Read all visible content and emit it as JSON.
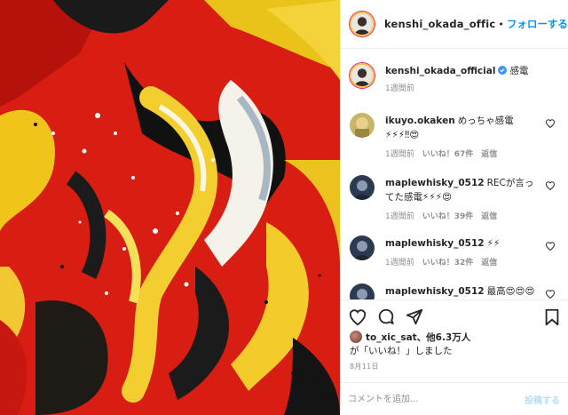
{
  "header": {
    "username": "kenshi_okada_offic",
    "separator": "•",
    "follow_label": "フォローする"
  },
  "caption": {
    "username": "kenshi_okada_official",
    "text": "感電",
    "time": "1週間前"
  },
  "comments": [
    {
      "user": "ikuyo.okaken",
      "text": "めっちゃ感電⚡⚡⚡‼😍",
      "time": "1週間前",
      "likes": "いいね！67件",
      "reply": "返信"
    },
    {
      "user": "maplewhisky_0512",
      "text": "RECが言ってた感電⚡⚡⚡😍",
      "time": "1週間前",
      "likes": "いいね！39件",
      "reply": "返信"
    },
    {
      "user": "maplewhisky_0512",
      "text": "⚡⚡",
      "time": "1週間前",
      "likes": "いいね！32件",
      "reply": "返信"
    },
    {
      "user": "maplewhisky_0512",
      "text": "最高😍😍😍",
      "time": "",
      "likes": "",
      "reply": ""
    }
  ],
  "likes": {
    "user": "to_xic_sat",
    "others": "、他6.3万人",
    "suffix": "が「いいね！」しました"
  },
  "date": "8月11日",
  "composer": {
    "placeholder": "コメントを追加...",
    "post_label": "投稿する"
  },
  "icons": {
    "like": "heart-icon",
    "comment": "comment-icon",
    "share": "share-icon",
    "save": "bookmark-icon",
    "verified": "verified-badge-icon"
  },
  "colors": {
    "link_blue": "#0095f6",
    "muted": "#8e8e8e",
    "text": "#262626"
  }
}
